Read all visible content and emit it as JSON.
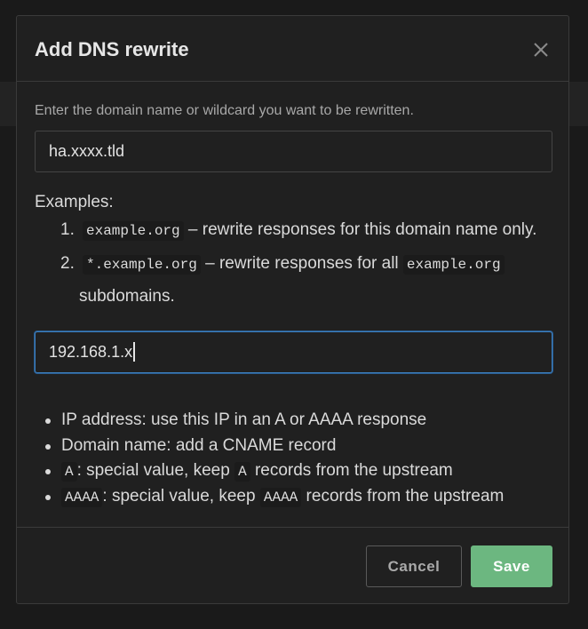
{
  "modal": {
    "title": "Add DNS rewrite"
  },
  "domain": {
    "hint": "Enter the domain name or wildcard you want to be rewritten.",
    "value": "ha.xxxx.tld"
  },
  "examples": {
    "title": "Examples:",
    "items": [
      {
        "number": "1.",
        "code": "example.org",
        "text": " – rewrite responses for this domain name only."
      },
      {
        "number": "2.",
        "code": "*.example.org",
        "text_before": " – rewrite responses for all ",
        "code2": "example.org",
        "text_after": "subdomains."
      }
    ]
  },
  "answer": {
    "value": "192.168.1.x"
  },
  "help": {
    "items": [
      {
        "text": "IP address: use this IP in an A or AAAA response"
      },
      {
        "text": "Domain name: add a CNAME record"
      },
      {
        "code": "A",
        "text_mid": ": special value, keep ",
        "code2": "A",
        "text_end": " records from the upstream"
      },
      {
        "code": "AAAA",
        "text_mid": ": special value, keep ",
        "code2": "AAAA",
        "text_end": " records from the upstream"
      }
    ]
  },
  "footer": {
    "cancel_label": "Cancel",
    "save_label": "Save"
  },
  "colors": {
    "save_button": "#6cb780",
    "focus_border": "#3d7fbf",
    "background": "#202020"
  },
  "icons": {
    "close": "close-icon"
  }
}
